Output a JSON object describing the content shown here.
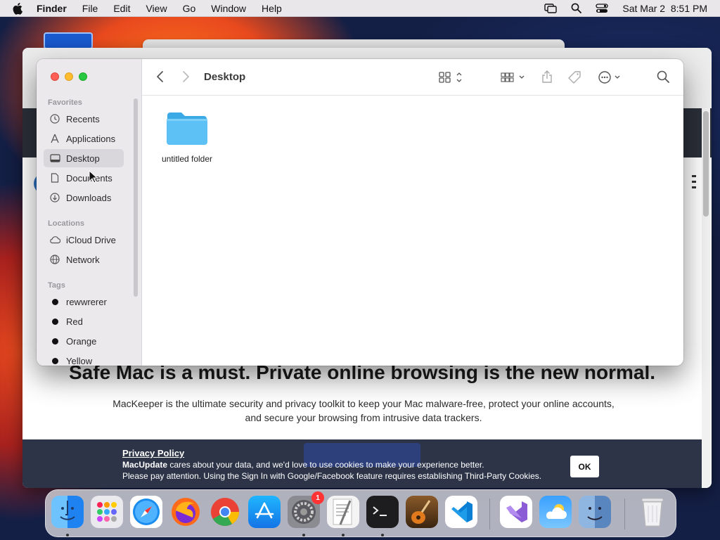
{
  "menubar": {
    "app_name": "Finder",
    "menus": [
      "File",
      "Edit",
      "View",
      "Go",
      "Window",
      "Help"
    ],
    "clock": "Sat Mar 2  8:51 PM"
  },
  "finder": {
    "title": "Desktop",
    "sidebar": {
      "favorites_header": "Favorites",
      "favorites": [
        {
          "label": "Recents",
          "icon": "clock-icon"
        },
        {
          "label": "Applications",
          "icon": "applications-icon"
        },
        {
          "label": "Desktop",
          "icon": "desktop-icon",
          "selected": true
        },
        {
          "label": "Documents",
          "icon": "document-icon"
        },
        {
          "label": "Downloads",
          "icon": "download-icon"
        }
      ],
      "locations_header": "Locations",
      "locations": [
        {
          "label": "iCloud Drive",
          "icon": "cloud-icon"
        },
        {
          "label": "Network",
          "icon": "network-icon"
        }
      ],
      "tags_header": "Tags",
      "tags": [
        {
          "label": "rewwrerer",
          "color": "#111111"
        },
        {
          "label": "Red",
          "color": "#111111"
        },
        {
          "label": "Orange",
          "color": "#111111"
        },
        {
          "label": "Yellow",
          "color": "#111111"
        }
      ]
    },
    "items": [
      {
        "label": "untitled folder",
        "icon": "folder-icon",
        "color": "#5ec1f5"
      }
    ]
  },
  "browser": {
    "headline": "Safe Mac is a must. Private online browsing is the new normal.",
    "subtext": "MacKeeper is the ultimate security and privacy toolkit to keep your Mac malware-free, protect your online accounts, and secure your browsing from intrusive data trackers.",
    "cookie": {
      "policy_link": "Privacy Policy",
      "brand": "MacUpdate",
      "line1_rest": " cares about your data, and we'd love to use cookies to make your experience better.",
      "line2": "Please pay attention. Using the Sign In with Google/Facebook feature requires establishing Third-Party Cookies.",
      "ok_label": "OK"
    }
  },
  "dock": {
    "apps": [
      {
        "name": "Finder",
        "icon": "finder-icon"
      },
      {
        "name": "Launchpad",
        "icon": "launchpad-icon"
      },
      {
        "name": "Safari",
        "icon": "safari-icon"
      },
      {
        "name": "Firefox",
        "icon": "firefox-icon"
      },
      {
        "name": "Chrome",
        "icon": "chrome-icon"
      },
      {
        "name": "App Store",
        "icon": "app-store-icon"
      },
      {
        "name": "System Settings",
        "icon": "settings-icon",
        "badge": "1"
      },
      {
        "name": "TextEdit",
        "icon": "textedit-icon"
      },
      {
        "name": "Terminal",
        "icon": "terminal-icon"
      },
      {
        "name": "GarageBand",
        "icon": "garageband-icon"
      },
      {
        "name": "Visual Studio Code",
        "icon": "vscode-icon"
      },
      {
        "name": "Visual Studio",
        "icon": "visual-studio-icon"
      },
      {
        "name": "Weather",
        "icon": "weather-icon"
      },
      {
        "name": "Finder Alt",
        "icon": "finder-alt-icon"
      },
      {
        "name": "Trash",
        "icon": "trash-icon"
      }
    ]
  }
}
